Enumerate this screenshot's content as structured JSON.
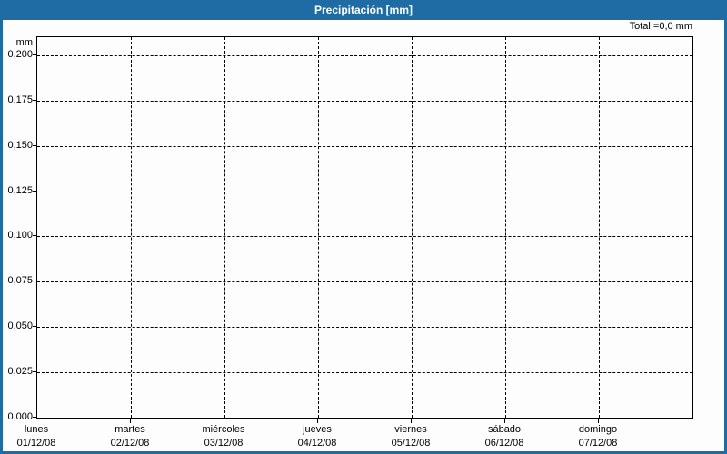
{
  "window": {
    "title": "Precipitación [mm]"
  },
  "chart_data": {
    "type": "bar",
    "title": "Precipitación [mm]",
    "total_annotation": "Total =0,0 mm",
    "grid": {
      "style": "dashed",
      "color": "#000000"
    },
    "legend": "none",
    "colors": {
      "titlebar": "#1e6ca3",
      "window_border": "#1e6ca3",
      "plot_border": "#000000",
      "background": "#fdfdfd",
      "text": "#000000"
    },
    "y_axis": {
      "unit": "mm",
      "min": 0,
      "max_tick": 0.2,
      "max_display": 0.21,
      "step": 0.025,
      "ticks": [
        {
          "value": 0.2,
          "label": "0,200"
        },
        {
          "value": 0.175,
          "label": "0,175"
        },
        {
          "value": 0.15,
          "label": "0,150"
        },
        {
          "value": 0.125,
          "label": "0,125"
        },
        {
          "value": 0.1,
          "label": "0,100"
        },
        {
          "value": 0.075,
          "label": "0,075"
        },
        {
          "value": 0.05,
          "label": "0,050"
        },
        {
          "value": 0.025,
          "label": "0,025"
        },
        {
          "value": 0.0,
          "label": "0,000"
        }
      ]
    },
    "x_axis": {
      "days": [
        {
          "name": "lunes",
          "date": "01/12/08"
        },
        {
          "name": "martes",
          "date": "02/12/08"
        },
        {
          "name": "miércoles",
          "date": "03/12/08"
        },
        {
          "name": "jueves",
          "date": "04/12/08"
        },
        {
          "name": "viernes",
          "date": "05/12/08"
        },
        {
          "name": "sábado",
          "date": "06/12/08"
        },
        {
          "name": "domingo",
          "date": "07/12/08"
        }
      ]
    },
    "values": [
      0,
      0,
      0,
      0,
      0,
      0,
      0
    ]
  }
}
